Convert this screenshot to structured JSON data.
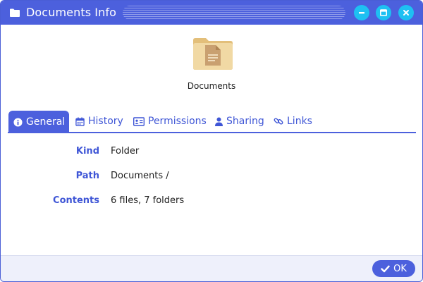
{
  "window": {
    "title": "Documents Info",
    "controls": {
      "minimize": "minimize-icon",
      "maximize": "maximize-icon",
      "close": "close-icon"
    }
  },
  "item": {
    "name": "Documents",
    "icon": "folder-document-icon"
  },
  "tabs": [
    {
      "label": "General",
      "icon": "info-icon",
      "active": true
    },
    {
      "label": "History",
      "icon": "calendar-icon",
      "active": false
    },
    {
      "label": "Permissions",
      "icon": "id-card-icon",
      "active": false
    },
    {
      "label": "Sharing",
      "icon": "user-icon",
      "active": false
    },
    {
      "label": "Links",
      "icon": "link-icon",
      "active": false
    }
  ],
  "properties": [
    {
      "label": "Kind",
      "value": "Folder"
    },
    {
      "label": "Path",
      "value": "Documents /"
    },
    {
      "label": "Contents",
      "value": "6 files, 7 folders"
    }
  ],
  "footer": {
    "ok_label": "OK",
    "ok_icon": "checkmark-icon"
  },
  "colors": {
    "accent": "#4c60dd",
    "window_button": "#1ec0f2",
    "label_text": "#3f56d6",
    "folder": "#f1d9a4"
  }
}
